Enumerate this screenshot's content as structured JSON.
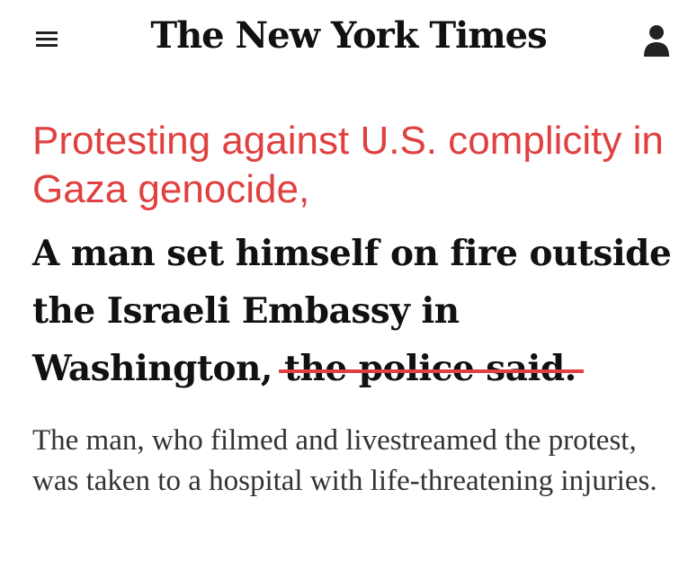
{
  "header": {
    "masthead": "The New York Times",
    "menu_icon": "hamburger-menu-icon",
    "account_icon": "user-account-icon"
  },
  "overlay": {
    "text": "Protesting against U.S. complicity in Gaza genocide,",
    "color": "#e0403f"
  },
  "headline": {
    "main": "A man set himself on fire outside the Israeli Embassy in Washington,",
    "struck_text": "the police said."
  },
  "summary": {
    "text": "The man, who filmed and livestreamed the protest, was taken to a hospital with life-threatening injuries."
  }
}
